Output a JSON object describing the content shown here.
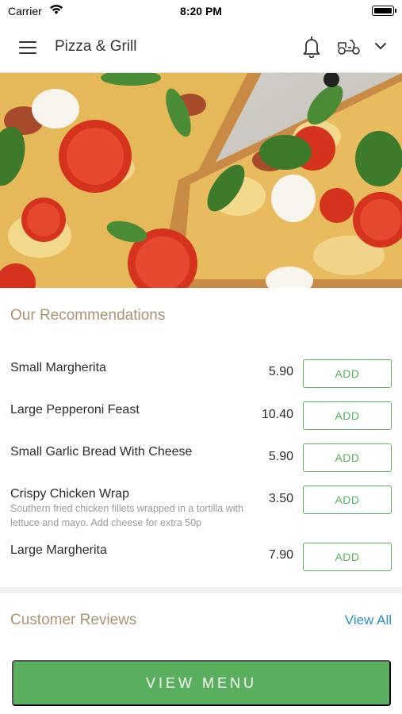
{
  "status_bar": {
    "carrier": "Carrier",
    "time": "8:20 PM"
  },
  "nav": {
    "title": "Pizza & Grill",
    "icons": [
      "menu-icon",
      "bell-icon",
      "scooter-icon",
      "chevron-down-icon"
    ]
  },
  "hero": {
    "image": "pizza-photo"
  },
  "recommendations": {
    "title": "Our Recommendations",
    "items": [
      {
        "name": "Small Margherita",
        "description": "",
        "price": "5.90",
        "button": "ADD"
      },
      {
        "name": "Large Pepperoni Feast",
        "description": "",
        "price": "10.40",
        "button": "ADD"
      },
      {
        "name": "Small Garlic Bread With Cheese",
        "description": "",
        "price": "5.90",
        "button": "ADD"
      },
      {
        "name": "Crispy Chicken Wrap",
        "description": "Southern fried chicken fillets wrapped in a tortilla with lettuce and mayo. Add cheese for extra 50p",
        "price": "3.50",
        "button": "ADD"
      },
      {
        "name": "Large Margherita",
        "description": "",
        "price": "7.90",
        "button": "ADD"
      }
    ]
  },
  "reviews": {
    "title": "Customer Reviews",
    "view_all": "View All"
  },
  "footer": {
    "view_menu": "VIEW MENU"
  },
  "colors": {
    "accent_green": "#5aaf5e",
    "section_title": "#a89470",
    "link_blue": "#2d8fc4"
  }
}
